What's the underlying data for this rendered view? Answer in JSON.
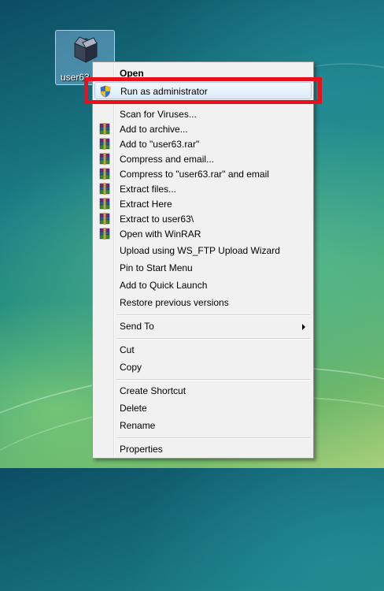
{
  "desktop": {
    "icon_label": "user63"
  },
  "context_menu": {
    "open": "Open",
    "run_as_admin": "Run as administrator",
    "scan_viruses": "Scan for Viruses...",
    "add_archive": "Add to archive...",
    "add_rar": "Add to \"user63.rar\"",
    "compress_email": "Compress and email...",
    "compress_rar_email": "Compress to \"user63.rar\" and email",
    "extract_files": "Extract files...",
    "extract_here": "Extract Here",
    "extract_to": "Extract to user63\\",
    "open_winrar": "Open with WinRAR",
    "upload_wsftp": "Upload using WS_FTP Upload Wizard",
    "pin_start": "Pin to Start Menu",
    "add_quick_launch": "Add to Quick Launch",
    "restore_versions": "Restore previous versions",
    "send_to": "Send To",
    "cut": "Cut",
    "copy": "Copy",
    "create_shortcut": "Create Shortcut",
    "delete": "Delete",
    "rename": "Rename",
    "properties": "Properties"
  },
  "colors": {
    "highlight_border": "#e8101a",
    "menu_background": "#f1f1f1"
  }
}
